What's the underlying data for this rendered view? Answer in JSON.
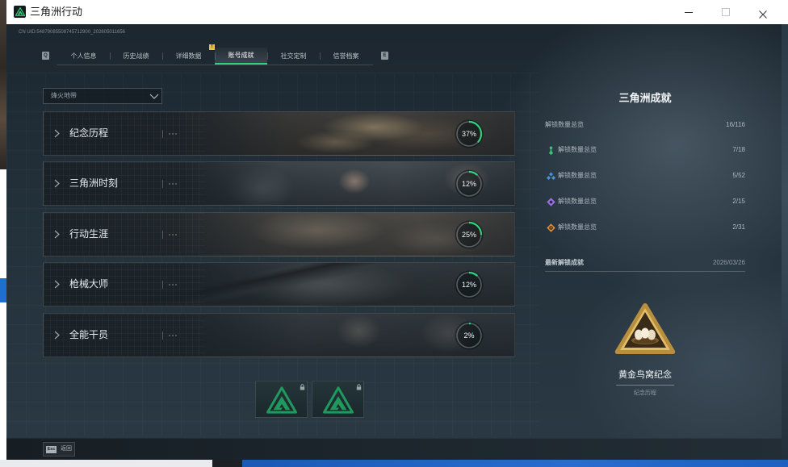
{
  "window": {
    "title": "三角洲行动",
    "controls": [
      "minimize-icon",
      "maximize-icon",
      "close-icon"
    ]
  },
  "uid": "CN UID:54879085508745712900_202605011656",
  "tabs": {
    "prev_key": "Q",
    "next_key": "E",
    "items": [
      {
        "label": "个人信息",
        "active": false
      },
      {
        "label": "历史战绩",
        "active": false
      },
      {
        "label": "详细数据",
        "active": false
      },
      {
        "label": "账号成就",
        "active": true,
        "badge": "!"
      },
      {
        "label": "社交定制",
        "active": false
      },
      {
        "label": "信誉档案",
        "active": false
      }
    ]
  },
  "filter": {
    "selected": "烽火地带"
  },
  "categories": [
    {
      "label": "纪念历程",
      "progress_text": "37%",
      "progress": 37
    },
    {
      "label": "三角洲时刻",
      "progress_text": "12%",
      "progress": 12
    },
    {
      "label": "行动生涯",
      "progress_text": "25%",
      "progress": 25
    },
    {
      "label": "枪械大师",
      "progress_text": "12%",
      "progress": 12
    },
    {
      "label": "全能干员",
      "progress_text": "2%",
      "progress": 2
    }
  ],
  "locked_slots": [
    {
      "locked": true,
      "icon": "lock-icon"
    },
    {
      "locked": true,
      "icon": "lock-icon"
    }
  ],
  "summary": {
    "title": "三角洲成就",
    "total_label": "解锁数量总览",
    "total_value": "16/116",
    "tiers": [
      {
        "label": "解锁数量总览",
        "value": "7/18",
        "color": "#35c27a",
        "icon": "green-tier-icon"
      },
      {
        "label": "解锁数量总览",
        "value": "5/52",
        "color": "#4b8fe0",
        "icon": "blue-tier-icon"
      },
      {
        "label": "解锁数量总览",
        "value": "2/15",
        "color": "#9a6fe0",
        "icon": "purple-tier-icon"
      },
      {
        "label": "解锁数量总览",
        "value": "2/31",
        "color": "#e08a3a",
        "icon": "orange-tier-icon"
      }
    ]
  },
  "latest": {
    "header": "最新解锁成就",
    "date": "2026/03/26",
    "name": "黄金鸟窝纪念",
    "category": "纪念历程",
    "icon": "golden-nest-badge-icon"
  },
  "footer": {
    "back_key": "Esc",
    "back_label": "返回"
  },
  "colors": {
    "accent": "#2fd27a",
    "logo_green": "#1f9a5c"
  }
}
